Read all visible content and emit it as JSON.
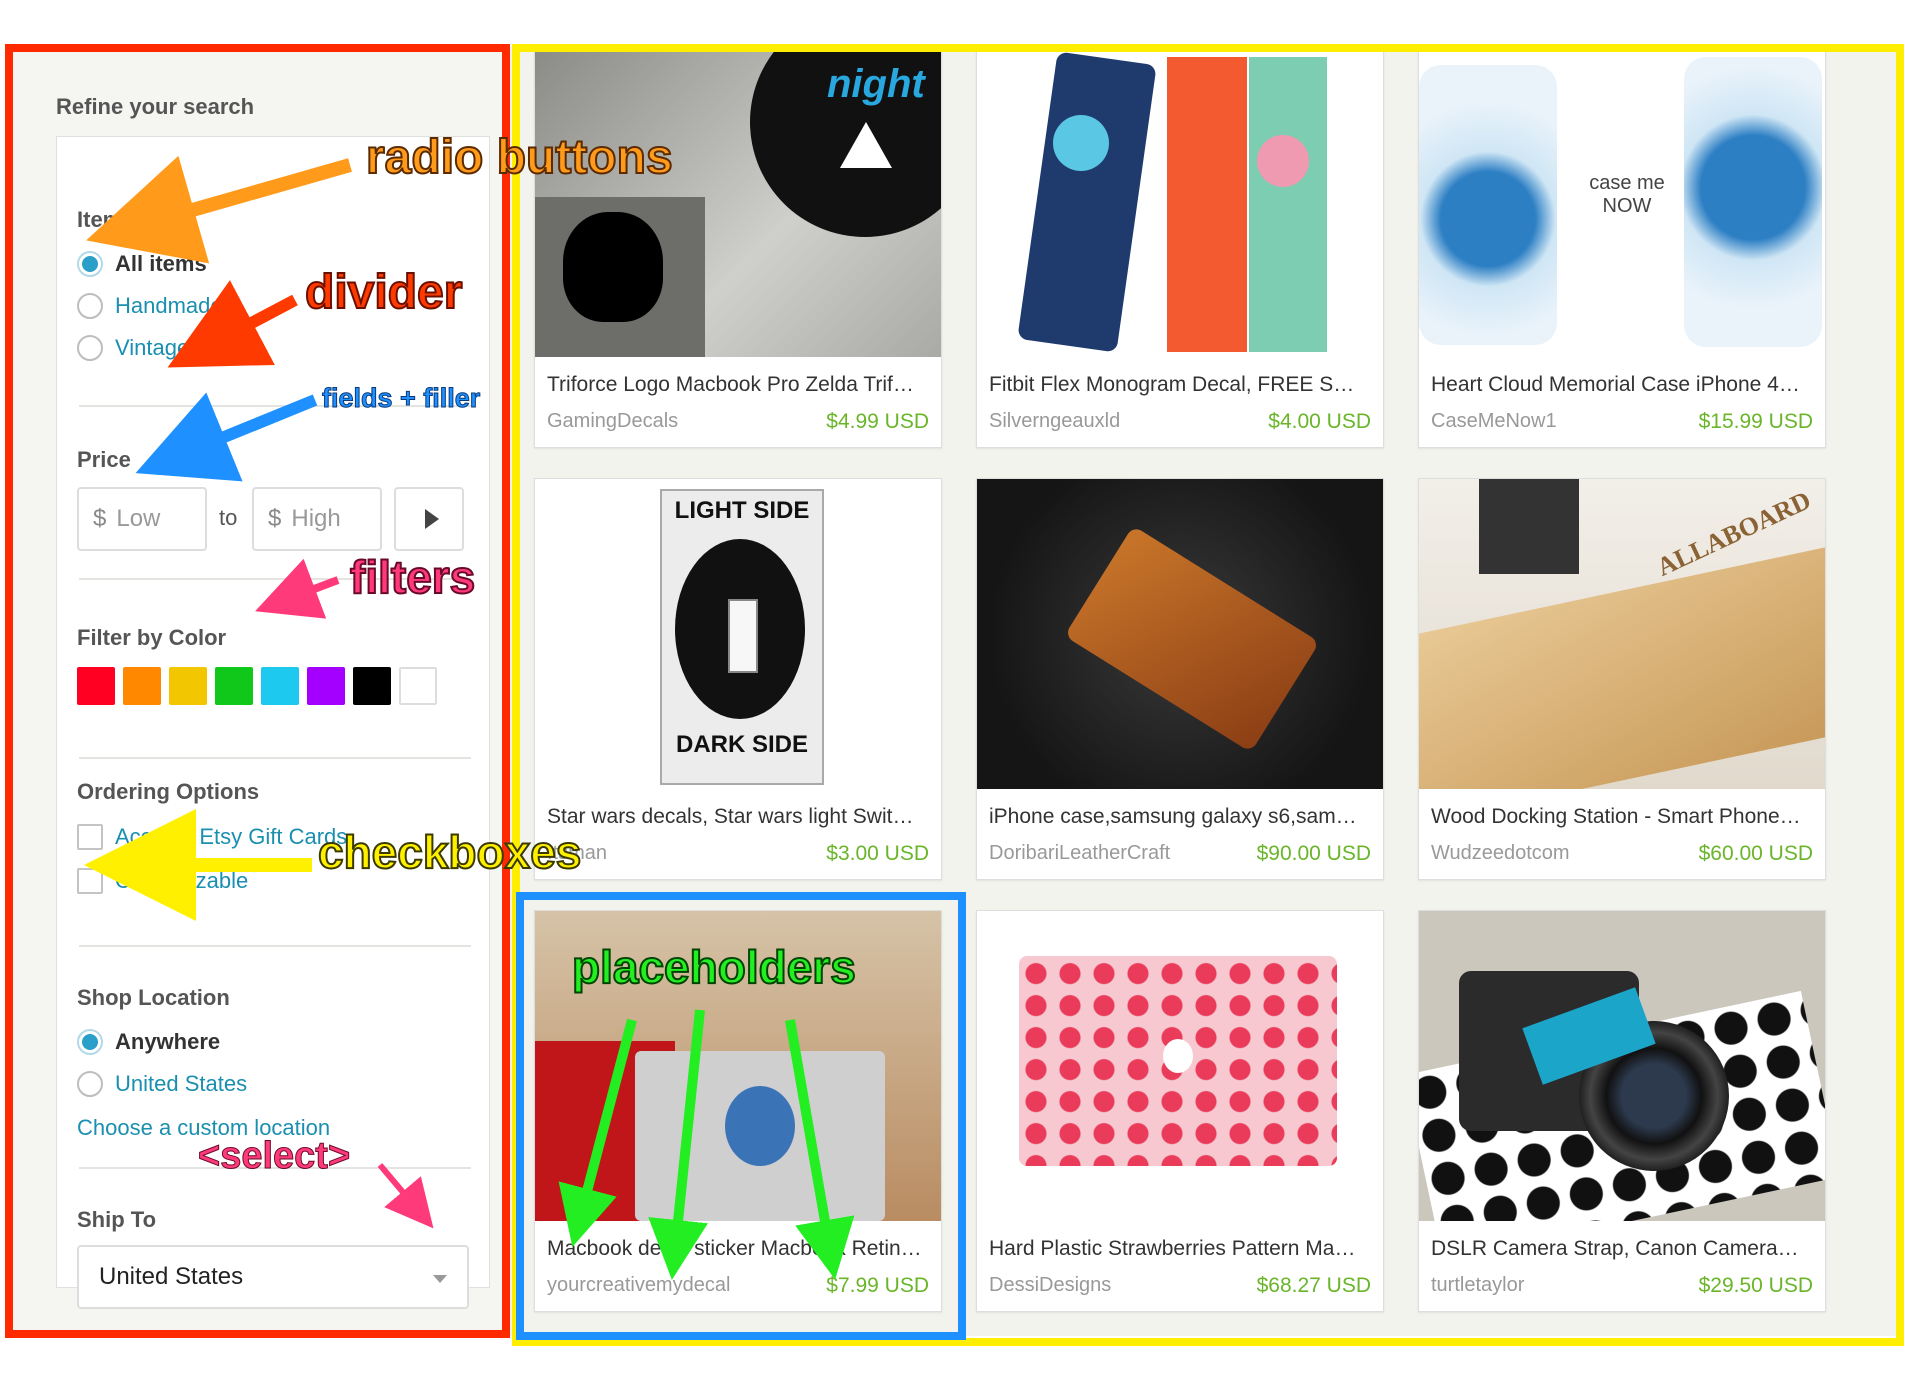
{
  "sidebar": {
    "title": "Refine your search",
    "item_type": {
      "heading": "Item Type",
      "options": [
        "All items",
        "Handmade",
        "Vintage"
      ]
    },
    "price": {
      "heading": "Price",
      "currency": "$",
      "low_placeholder": "Low",
      "to": "to",
      "high_placeholder": "High"
    },
    "color": {
      "heading": "Filter by Color",
      "swatches": [
        "#ff0022",
        "#ff8800",
        "#f2c600",
        "#10c81a",
        "#1ec9f0",
        "#a300ff",
        "#000000",
        "#ffffff"
      ]
    },
    "ordering": {
      "heading": "Ordering Options",
      "options": [
        "Accepts Etsy Gift Cards",
        "Customizable"
      ]
    },
    "location": {
      "heading": "Shop Location",
      "options": [
        "Anywhere",
        "United States"
      ],
      "custom_link": "Choose a custom location"
    },
    "ship_to": {
      "heading": "Ship To",
      "value": "United States"
    }
  },
  "listings": [
    {
      "title": "Triforce Logo Macbook Pro Zelda Trif…",
      "shop": "GamingDecals",
      "price": "$4.99 USD",
      "thumb_text": "night"
    },
    {
      "title": "Fitbit Flex Monogram Decal, FREE S…",
      "shop": "Silverngeauxld",
      "price": "$4.00 USD"
    },
    {
      "title": "Heart Cloud Memorial Case iPhone 4…",
      "shop": "CaseMeNow1",
      "price": "$15.99 USD",
      "thumb_text": "case me NOW"
    },
    {
      "title": "Star wars decals, Star wars light Swit…",
      "shop": "Itsman",
      "price": "$3.00 USD",
      "thumb_text_top": "LIGHT SIDE",
      "thumb_text_bottom": "DARK SIDE"
    },
    {
      "title": "iPhone case,samsung galaxy s6,sam…",
      "shop": "DoribariLeatherCraft",
      "price": "$90.00 USD"
    },
    {
      "title": "Wood Docking Station - Smart Phone…",
      "shop": "Wudzeedotcom",
      "price": "$60.00 USD",
      "thumb_text": "ALLABOARD"
    },
    {
      "title": "Macbook decal sticker Macbook Retina 13 …",
      "shop": "yourcreativemydecal",
      "price": "$7.99 USD"
    },
    {
      "title": "Hard Plastic Strawberries Pattern Ma…",
      "shop": "DessiDesigns",
      "price": "$68.27 USD"
    },
    {
      "title": "DSLR Camera Strap, Canon Camera…",
      "shop": "turtletaylor",
      "price": "$29.50 USD"
    }
  ],
  "annotations": {
    "radio": "radio buttons",
    "divider": "divider",
    "fields": "fields + filler",
    "filters": "filters",
    "checkboxes": "checkboxes",
    "placeholders": "placeholders",
    "select": "<select>"
  },
  "colors": {
    "frame_sidebar": "#ff2a00",
    "frame_grid": "#ffee00",
    "frame_card": "#1e90ff",
    "link": "#1a8fb0",
    "price": "#6ab529"
  }
}
